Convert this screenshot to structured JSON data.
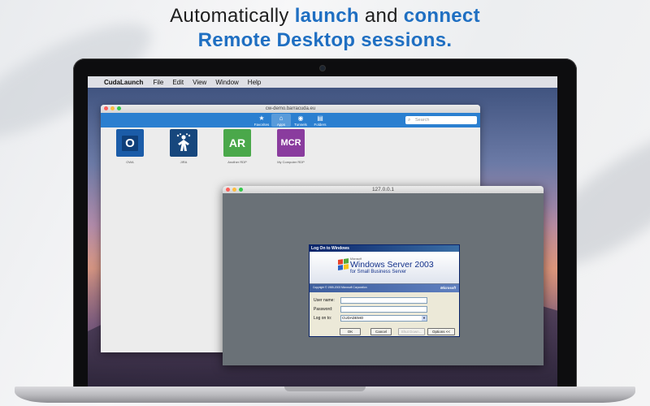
{
  "headline": {
    "line1_pre": "Automatically ",
    "line1_em1": "launch",
    "line1_mid": " and ",
    "line1_em2": "connect",
    "line2_em": "Remote Desktop sessions."
  },
  "colors": {
    "accent_blue": "#1f6fc2",
    "toolbar_blue": "#2b7fd0"
  },
  "menubar": {
    "apple": "",
    "app_name": "CudaLaunch",
    "items": [
      "File",
      "Edit",
      "View",
      "Window",
      "Help"
    ]
  },
  "window_main": {
    "title": "cw-demo.barracuda.eu",
    "toolbar": [
      {
        "label": "Favorites",
        "icon": "star-icon",
        "glyph": "★"
      },
      {
        "label": "Apps",
        "icon": "apps-icon",
        "glyph": "⌂"
      },
      {
        "label": "Tunnels",
        "icon": "tunnels-icon",
        "glyph": "◉"
      },
      {
        "label": "Folders",
        "icon": "folders-icon",
        "glyph": "▤"
      }
    ],
    "active_tab": "Apps",
    "search_placeholder": "Search",
    "apps": [
      {
        "tile_text": "O",
        "label": "OWA",
        "color": "#1b5ca8"
      },
      {
        "tile_text": "",
        "label": "JIRA",
        "color": "#17477d"
      },
      {
        "tile_text": "AR",
        "label": "Another RDP",
        "color": "#4aa84a"
      },
      {
        "tile_text": "MCR",
        "label": "My Computer RDP",
        "color": "#8a3c9e"
      }
    ]
  },
  "window_rdp": {
    "title": "127.0.0.1",
    "dialog": {
      "caption": "Log On to Windows",
      "ms_small": "Microsoft",
      "product": "Windows Server 2003",
      "edition": "for Small Business Server",
      "copyright": "Copyright © 1985-2003  Microsoft Corporation",
      "ms_logo": "Microsoft",
      "fields": [
        {
          "label": "User name:",
          "value": ""
        },
        {
          "label": "Password:",
          "value": ""
        },
        {
          "label": "Log on to:",
          "value": "CUDADEMO"
        }
      ],
      "buttons": [
        "OK",
        "Cancel",
        "Shut Down...",
        "Options <<"
      ]
    }
  }
}
